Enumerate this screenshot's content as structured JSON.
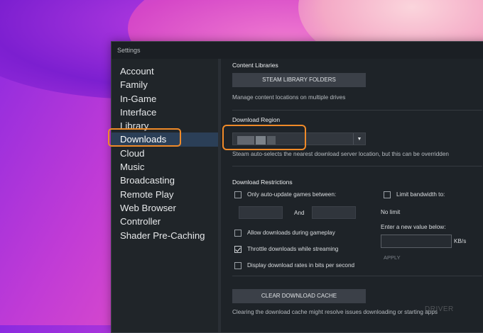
{
  "window": {
    "title": "Settings"
  },
  "sidebar": {
    "items": [
      {
        "label": "Account"
      },
      {
        "label": "Family"
      },
      {
        "label": "In-Game"
      },
      {
        "label": "Interface"
      },
      {
        "label": "Library"
      },
      {
        "label": "Downloads",
        "active": true
      },
      {
        "label": "Cloud"
      },
      {
        "label": "Music"
      },
      {
        "label": "Broadcasting"
      },
      {
        "label": "Remote Play"
      },
      {
        "label": "Web Browser"
      },
      {
        "label": "Controller"
      },
      {
        "label": "Shader Pre-Caching"
      }
    ]
  },
  "content_libraries": {
    "title": "Content Libraries",
    "button_label": "STEAM LIBRARY FOLDERS",
    "description": "Manage content locations on multiple drives"
  },
  "download_region": {
    "title": "Download Region",
    "selected_value": "",
    "description": "Steam auto-selects the nearest download server location, but this can be overridden"
  },
  "download_restrictions": {
    "title": "Download Restrictions",
    "auto_update_label": "Only auto-update games between:",
    "auto_update_checked": false,
    "and_label": "And",
    "allow_during_gameplay_label": "Allow downloads during gameplay",
    "allow_during_gameplay_checked": false,
    "throttle_label": "Throttle downloads while streaming",
    "throttle_checked": true,
    "bits_label": "Display download rates in bits per second",
    "bits_checked": false,
    "limit_bandwidth_label": "Limit bandwidth to:",
    "limit_bandwidth_checked": false,
    "no_limit_label": "No limit",
    "enter_value_label": "Enter a new value below:",
    "unit_label": "KB/s",
    "apply_label": "APPLY"
  },
  "clear_cache": {
    "button_label": "CLEAR DOWNLOAD CACHE",
    "description": "Clearing the download cache might resolve issues downloading or starting apps"
  },
  "watermark": "DRIVER",
  "colors": {
    "highlight": "#f08a28",
    "active_nav": "#2b3f57",
    "window_bg": "#1e2328"
  }
}
